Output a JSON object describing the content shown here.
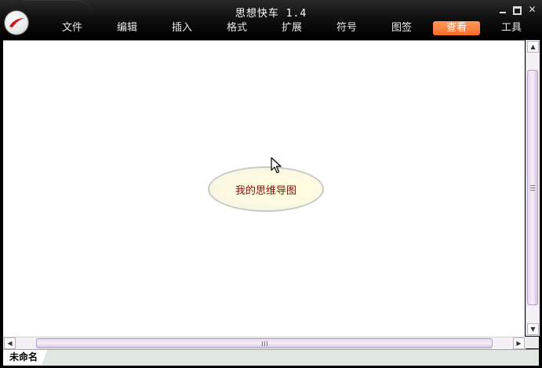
{
  "window": {
    "title": "思想快车 1.4"
  },
  "icons": {
    "logo": "app-logo-icon",
    "minimize": "minimize-icon",
    "maximize": "maximize-icon",
    "close": "close-icon"
  },
  "menu": {
    "items": [
      {
        "label": "文件"
      },
      {
        "label": "编辑"
      },
      {
        "label": "插入"
      },
      {
        "label": "格式"
      },
      {
        "label": "扩展"
      },
      {
        "label": "符号"
      },
      {
        "label": "图签"
      },
      {
        "label": "查看",
        "active": true
      },
      {
        "label": "工具"
      }
    ],
    "active_color": "#FF7A3A"
  },
  "canvas": {
    "central_node": {
      "text": "我的思维导图"
    }
  },
  "tabs": [
    {
      "label": "未命名"
    }
  ]
}
